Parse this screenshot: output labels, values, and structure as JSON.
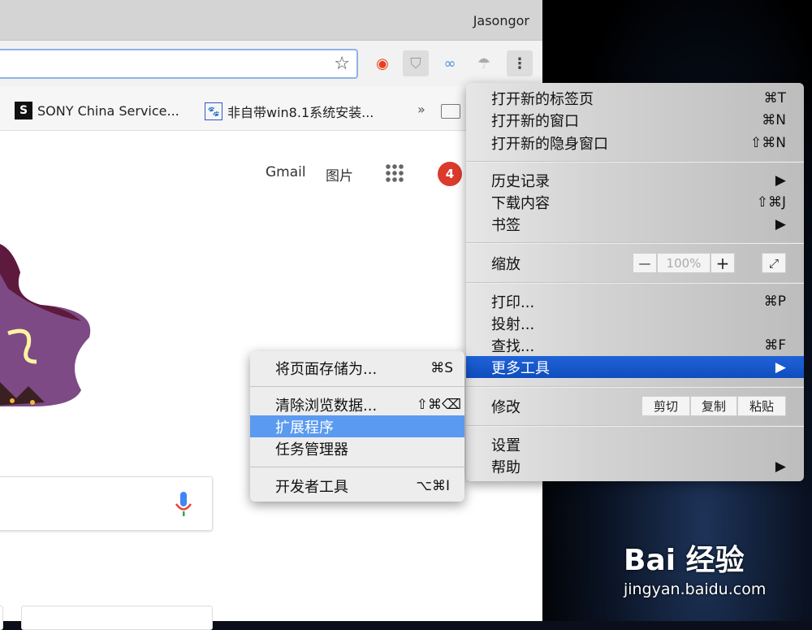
{
  "window": {
    "user": "Jasongor"
  },
  "toolbar": {
    "extensions": [
      "weibo-icon",
      "shield-icon",
      "link-icon",
      "parachute-icon"
    ],
    "menu_icon": "⋮"
  },
  "bookmarks": {
    "items": [
      {
        "icon": "S",
        "label": "SONY China Service..."
      },
      {
        "icon": "🐾",
        "label": "非自带win8.1系统安装..."
      }
    ],
    "overflow": "»"
  },
  "google": {
    "gmail": "Gmail",
    "images": "图片",
    "notifications": "4"
  },
  "main_menu": {
    "new_tab": {
      "label": "打开新的标签页",
      "key": "⌘T"
    },
    "new_window": {
      "label": "打开新的窗口",
      "key": "⌘N"
    },
    "incognito": {
      "label": "打开新的隐身窗口",
      "key": "⇧⌘N"
    },
    "history": {
      "label": "历史记录",
      "key": "▶"
    },
    "downloads": {
      "label": "下载内容",
      "key": "⇧⌘J"
    },
    "bookmarks": {
      "label": "书签",
      "key": "▶"
    },
    "zoom": {
      "label": "缩放",
      "minus": "—",
      "value": "100%",
      "plus": "+",
      "fullscreen": "⤢"
    },
    "print": {
      "label": "打印...",
      "key": "⌘P"
    },
    "cast": {
      "label": "投射..."
    },
    "find": {
      "label": "查找...",
      "key": "⌘F"
    },
    "more_tools": {
      "label": "更多工具",
      "key": "▶"
    },
    "edit": {
      "label": "修改",
      "cut": "剪切",
      "copy": "复制",
      "paste": "粘贴"
    },
    "settings": {
      "label": "设置"
    },
    "help": {
      "label": "帮助",
      "key": "▶"
    }
  },
  "sub_menu": {
    "save_page": {
      "label": "将页面存储为...",
      "key": "⌘S"
    },
    "clear_data": {
      "label": "清除浏览数据...",
      "key": "⇧⌘⌫"
    },
    "extensions": {
      "label": "扩展程序"
    },
    "task_manager": {
      "label": "任务管理器"
    },
    "dev_tools": {
      "label": "开发者工具",
      "key": "⌥⌘I"
    }
  },
  "watermark": {
    "brand": "Bai 经验",
    "url": "jingyan.baidu.com"
  }
}
